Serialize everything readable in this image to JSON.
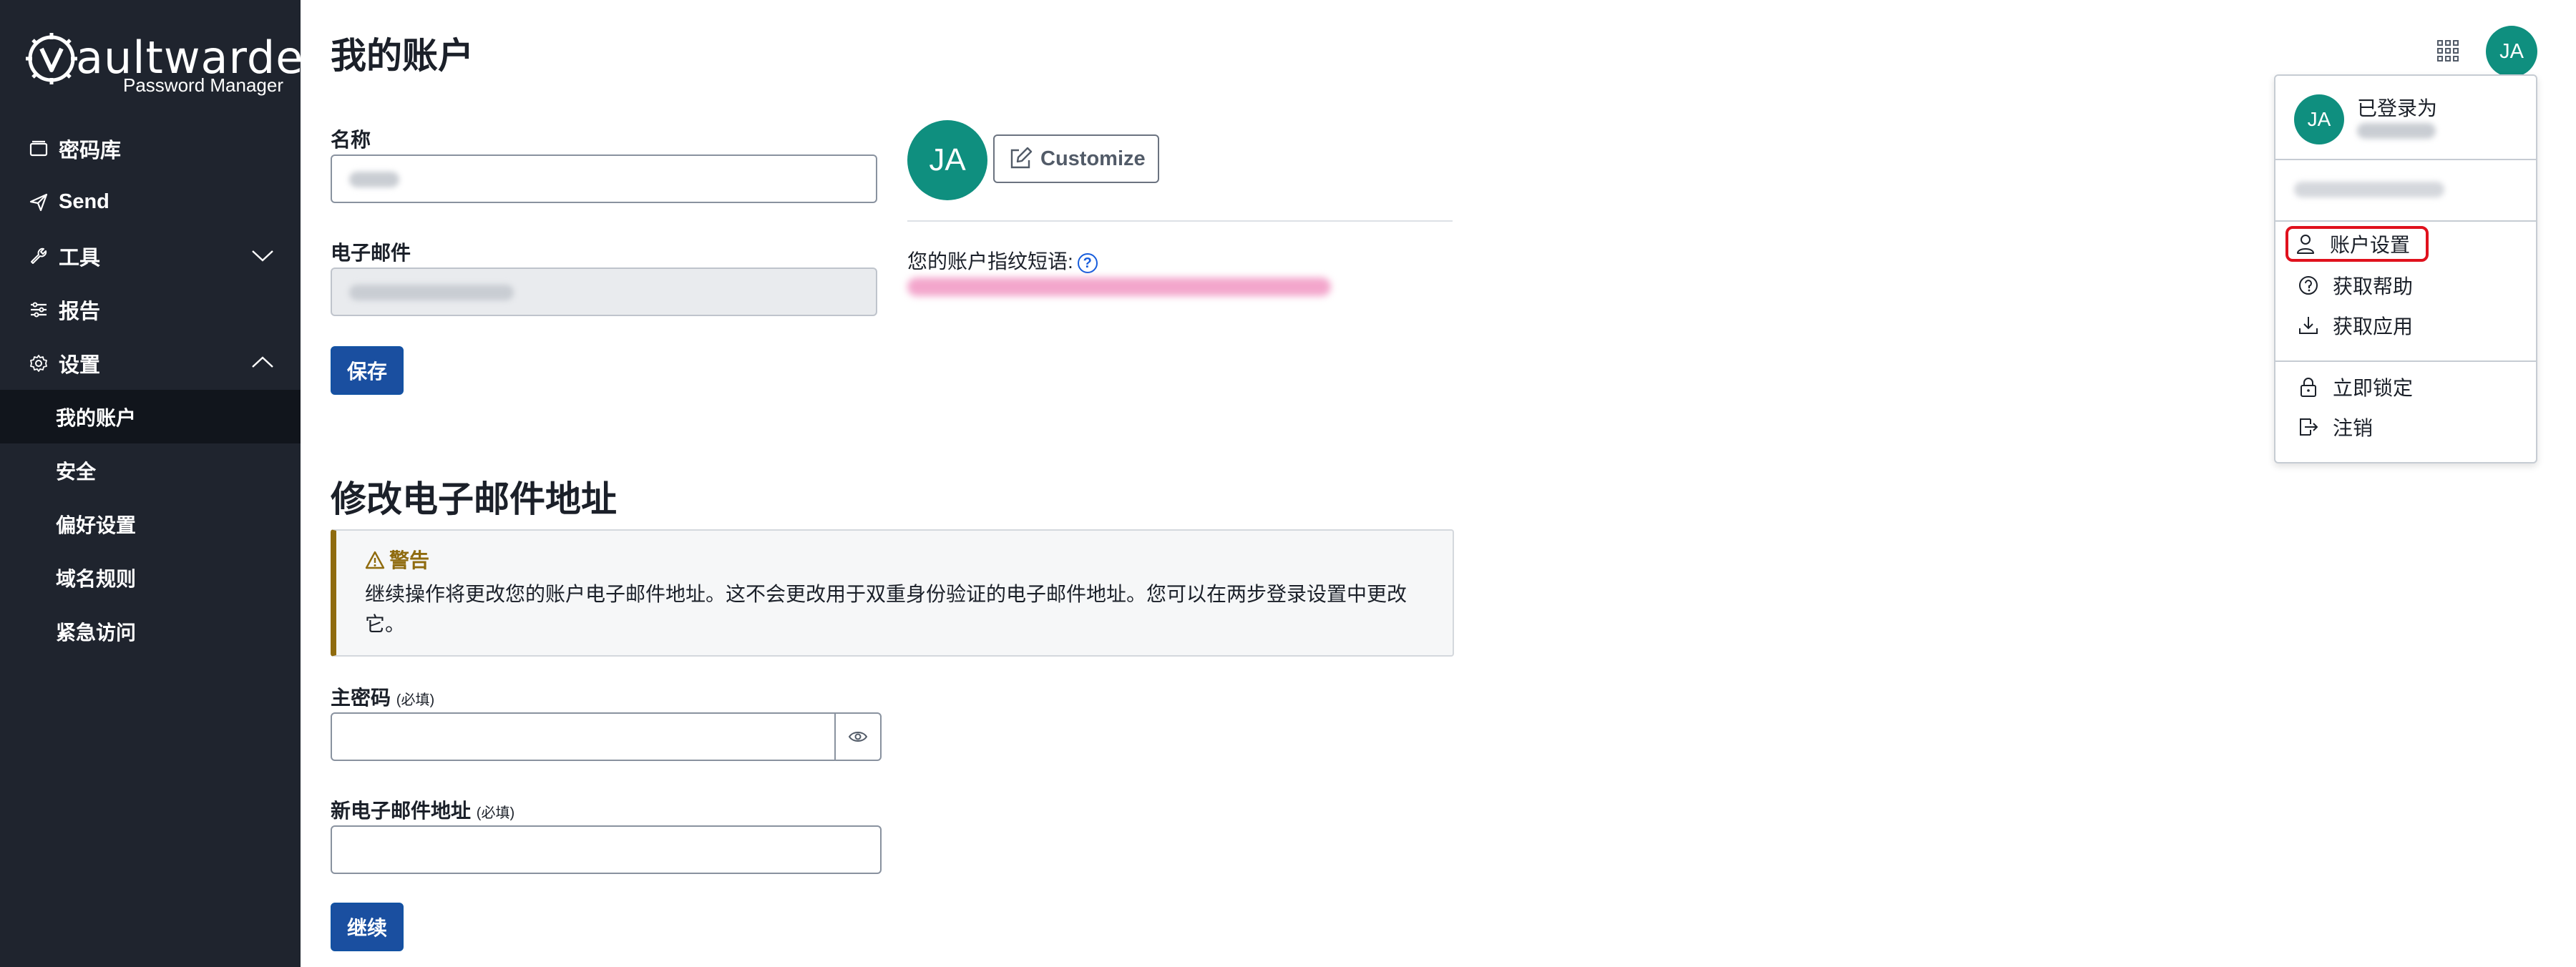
{
  "brand": {
    "name": "aultwarden",
    "subtitle": "Password Manager"
  },
  "sidebar": {
    "items": [
      {
        "label": "密码库",
        "icon": "vault-icon"
      },
      {
        "label": "Send",
        "icon": "send-icon"
      },
      {
        "label": "工具",
        "icon": "wrench-icon"
      },
      {
        "label": "报告",
        "icon": "report-icon"
      },
      {
        "label": "设置",
        "icon": "gear-icon"
      }
    ],
    "settings_sub": [
      {
        "label": "我的账户",
        "active": true
      },
      {
        "label": "安全"
      },
      {
        "label": "偏好设置"
      },
      {
        "label": "域名规则"
      },
      {
        "label": "紧急访问"
      }
    ]
  },
  "account": {
    "title": "我的账户",
    "name_label": "名称",
    "email_label": "电子邮件",
    "save_label": "保存",
    "avatar_initials": "JA",
    "customize_label": "Customize",
    "fingerprint_label": "您的账户指纹短语:"
  },
  "change_email": {
    "title": "修改电子邮件地址",
    "warning_title": "警告",
    "warning_body": "继续操作将更改您的账户电子邮件地址。这不会更改用于双重身份验证的电子邮件地址。您可以在两步登录设置中更改它。",
    "master_password_label": "主密码",
    "new_email_label": "新电子邮件地址",
    "required": "(必填)",
    "continue_label": "继续"
  },
  "header": {
    "avatar_initials": "JA"
  },
  "account_menu": {
    "logged_in_as": "已登录为",
    "avatar_initials": "JA",
    "items": [
      {
        "label": "账户设置",
        "icon": "user-icon"
      },
      {
        "label": "获取帮助",
        "icon": "question-icon"
      },
      {
        "label": "获取应用",
        "icon": "download-icon"
      },
      {
        "label": "立即锁定",
        "icon": "lock-icon"
      },
      {
        "label": "注销",
        "icon": "sign-out-icon"
      }
    ]
  },
  "colors": {
    "sidebar": "#1f242e",
    "primary": "#1a4fa0",
    "avatar": "#0f8f7f",
    "warning": "#8f6b0e",
    "highlight": "#e0111d"
  }
}
